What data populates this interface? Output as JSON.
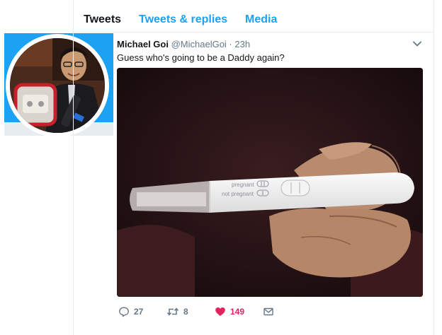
{
  "tabs": {
    "tweets": "Tweets",
    "replies": "Tweets & replies",
    "media": "Media"
  },
  "tweet": {
    "author_name": "Michael Goi",
    "handle_time": "@MichaelGoi · 23h",
    "text": "Guess who's going to be a Daddy again?",
    "image_text": {
      "pregnant": "pregnant",
      "not_pregnant": "not pregnant"
    }
  },
  "actions": {
    "reply_count": "27",
    "retweet_count": "8",
    "like_count": "149"
  },
  "colors": {
    "accent": "#1da1f2",
    "like": "#e0245e",
    "muted": "#657786"
  },
  "icons": {
    "menu": "chevron-down-icon",
    "reply": "reply-icon",
    "retweet": "retweet-icon",
    "like": "heart-icon",
    "dm": "envelope-icon"
  }
}
